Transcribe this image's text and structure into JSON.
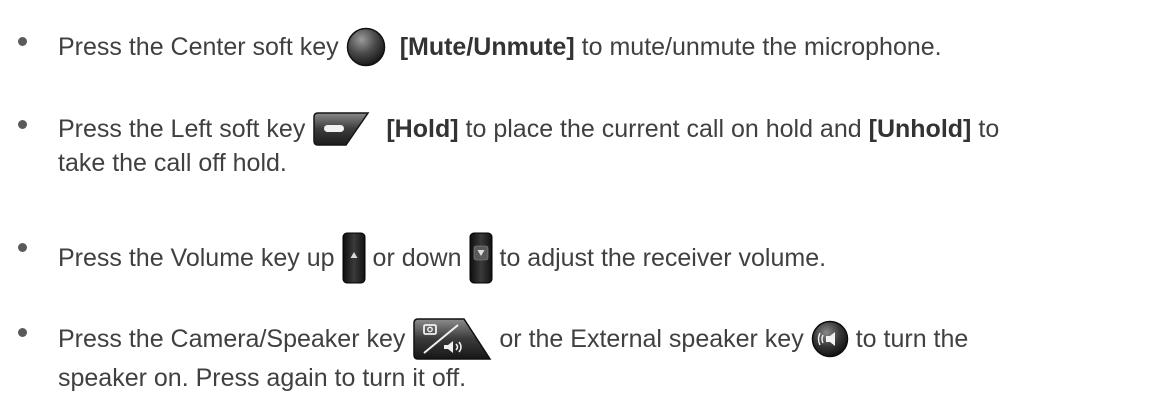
{
  "items": [
    {
      "pre": "Press the Center soft key",
      "icon": "center-soft-key-icon",
      "bold": "[Mute/Unmute]",
      "post": "to mute/unmute the microphone."
    },
    {
      "pre": "Press the Left soft key",
      "icon": "left-soft-key-icon",
      "bold": "[Hold]",
      "mid": "to place the current call on hold and",
      "bold2": "[Unhold]",
      "post": "to",
      "line2": "take the call off hold."
    },
    {
      "pre": "Press the Volume key up",
      "icon": "volume-up-key-icon",
      "mid": "or down",
      "icon2": "volume-down-key-icon",
      "post": "to adjust the receiver volume."
    },
    {
      "pre": "Press the Camera/Speaker key",
      "icon": "camera-speaker-key-icon",
      "mid": "or the External speaker key",
      "icon2": "external-speaker-key-icon",
      "post": "to turn the",
      "line2": "speaker on. Press again to turn it off."
    }
  ]
}
